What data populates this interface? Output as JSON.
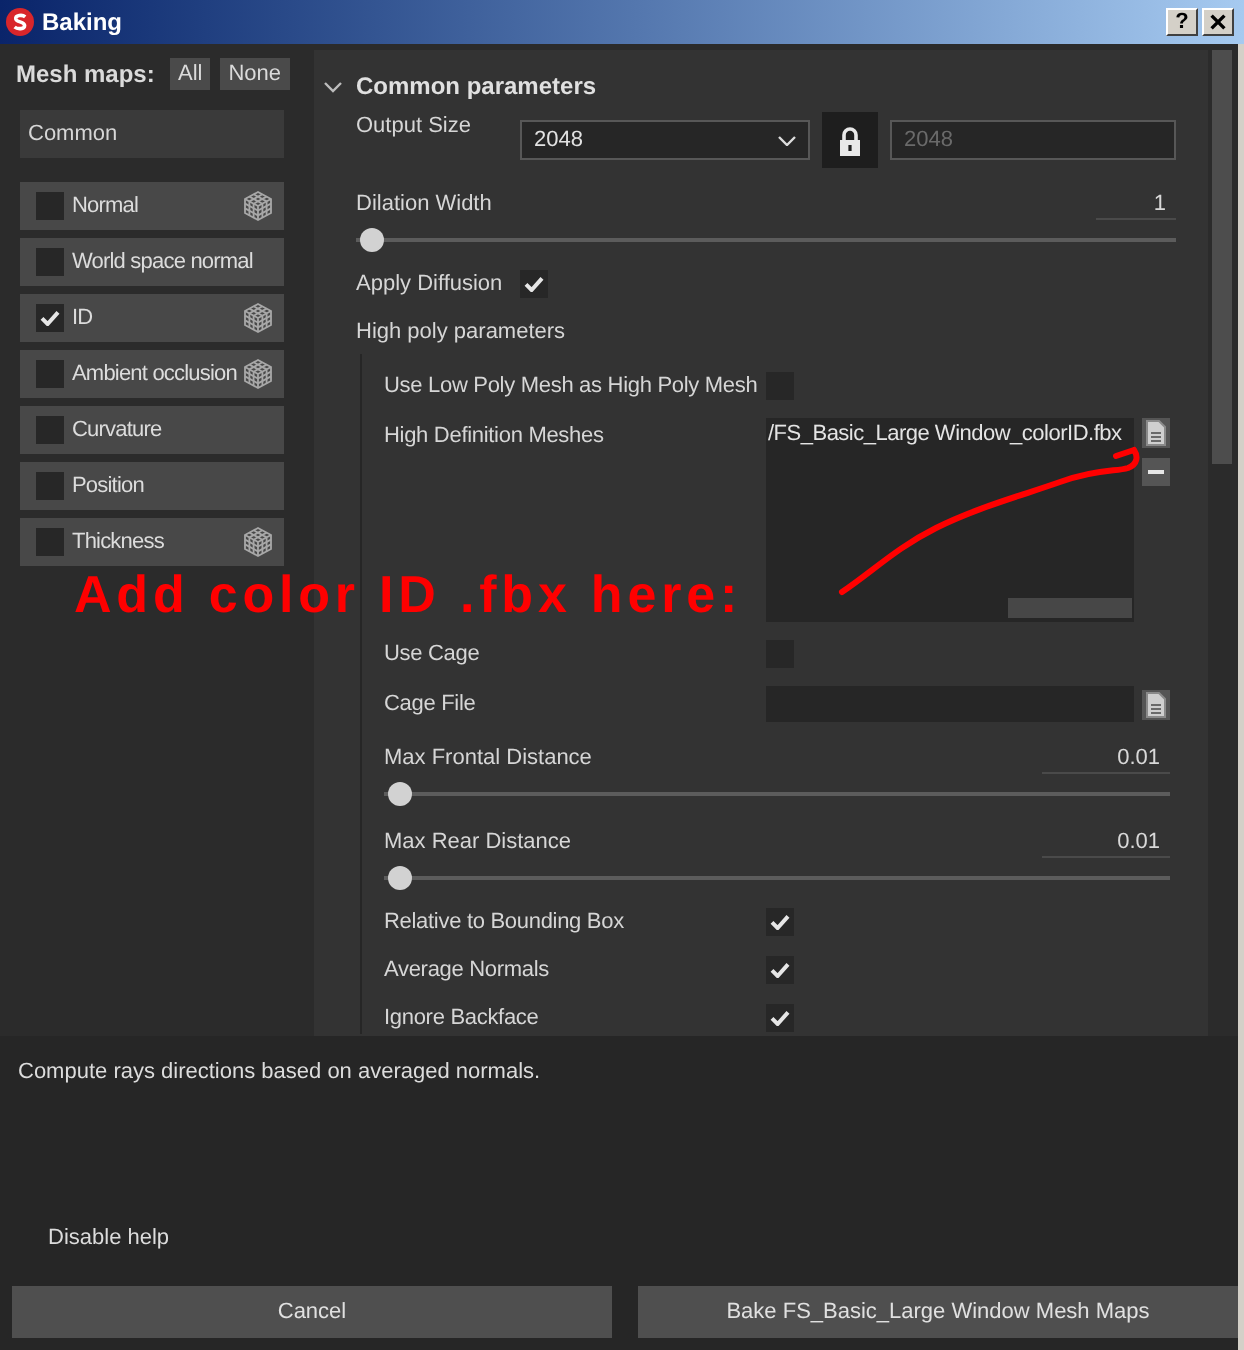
{
  "window": {
    "title": "Baking",
    "help_button": "?"
  },
  "sidebar": {
    "label": "Mesh maps:",
    "buttons": [
      "All",
      "None"
    ],
    "group": "Common",
    "maps": [
      {
        "label": "Normal",
        "checked": false,
        "has_icon": true
      },
      {
        "label": "World space normal",
        "checked": false,
        "has_icon": false
      },
      {
        "label": "ID",
        "checked": true,
        "has_icon": true
      },
      {
        "label": "Ambient occlusion",
        "checked": false,
        "has_icon": true
      },
      {
        "label": "Curvature",
        "checked": false,
        "has_icon": false
      },
      {
        "label": "Position",
        "checked": false,
        "has_icon": false
      },
      {
        "label": "Thickness",
        "checked": false,
        "has_icon": true
      }
    ]
  },
  "panel": {
    "section": {
      "title": "Common parameters",
      "expanded": true
    },
    "output_size": {
      "label": "Output Size",
      "value": "2048",
      "locked": true,
      "linked_value": "2048",
      "linked_disabled": true
    },
    "params": [
      {
        "kind": "slider",
        "label": "Dilation Width",
        "value": "1",
        "level": 0.02
      },
      {
        "kind": "checkbox",
        "label": "Apply Diffusion",
        "checked": true
      },
      {
        "kind": "heading",
        "label": "High poly parameters"
      }
    ],
    "high_poly": [
      {
        "kind": "checkbox",
        "label": "Use Low Poly Mesh as High Poly Mesh",
        "checked": false
      },
      {
        "kind": "file_list",
        "label": "High Definition Meshes",
        "files": [
          "/FS_Basic_Large Window_colorID.fbx"
        ]
      },
      {
        "kind": "checkbox",
        "label": "Use Cage",
        "checked": false
      },
      {
        "kind": "file",
        "label": "Cage File"
      },
      {
        "kind": "slider",
        "label": "Max Frontal Distance",
        "value": "0.01",
        "level": 0.02
      },
      {
        "kind": "slider",
        "label": "Max Rear Distance",
        "value": "0.01",
        "level": 0.02
      },
      {
        "kind": "checkbox",
        "label": "Relative to Bounding Box",
        "checked": true
      },
      {
        "kind": "checkbox",
        "label": "Average Normals",
        "checked": true
      },
      {
        "kind": "checkbox",
        "label": "Ignore Backface",
        "checked": true
      }
    ]
  },
  "annotation": {
    "text": "Add color ID .fbx here:"
  },
  "help": {
    "text": "Compute rays directions based on averaged normals.",
    "toggle": "Disable help"
  },
  "buttons": [
    "Cancel",
    "Bake FS_Basic_Large Window Mesh Maps"
  ]
}
